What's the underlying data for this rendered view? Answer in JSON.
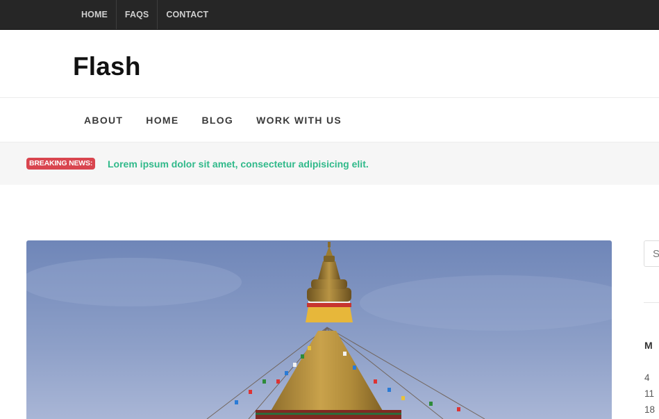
{
  "topbar": {
    "menu": [
      "HOME",
      "FAQS",
      "CONTACT"
    ]
  },
  "header": {
    "site_title": "Flash"
  },
  "main_nav": {
    "items": [
      "ABOUT",
      "HOME",
      "BLOG",
      "WORK WITH US"
    ]
  },
  "breaking_news": {
    "label": "BREAKING NEWS:",
    "headline": "Lorem ipsum dolor sit amet, consectetur adipisicing elit."
  },
  "sidebar": {
    "search_placeholder": "Search",
    "calendar": {
      "day_header": "M",
      "days": [
        "4",
        "11",
        "18"
      ]
    }
  },
  "colors": {
    "topbar_bg": "#262626",
    "breaking_badge": "#d9454f",
    "breaking_text": "#30b98a"
  }
}
